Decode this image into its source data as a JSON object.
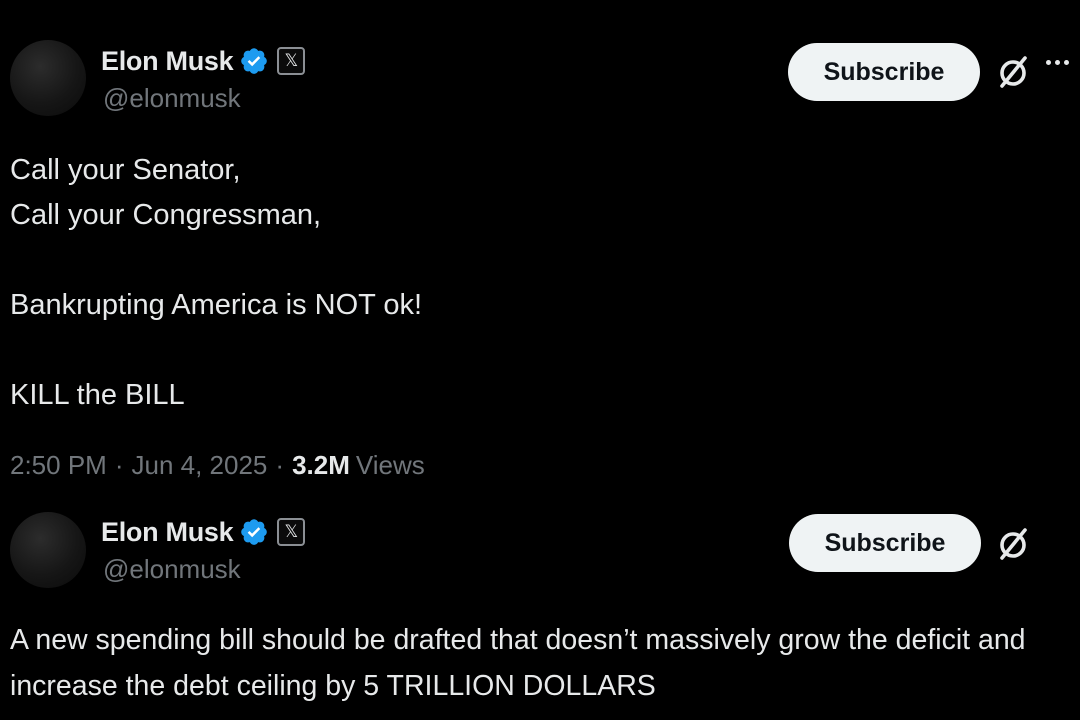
{
  "posts": [
    {
      "author": {
        "display_name": "Elon Musk",
        "handle": "@elonmusk",
        "verified_icon": "verified-badge-icon",
        "affiliate_icon": "x-logo-icon",
        "affiliate_glyph": "𝕏"
      },
      "subscribe_label": "Subscribe",
      "text": "Call your Senator,\nCall your Congressman,\n\nBankrupting America is NOT ok!\n\nKILL the BILL",
      "time": "2:50 PM",
      "date": "Jun 4, 2025",
      "separator": "·",
      "views_count": "3.2M",
      "views_label": "Views"
    },
    {
      "author": {
        "display_name": "Elon Musk",
        "handle": "@elonmusk",
        "verified_icon": "verified-badge-icon",
        "affiliate_icon": "x-logo-icon",
        "affiliate_glyph": "𝕏"
      },
      "subscribe_label": "Subscribe",
      "text": "A new spending bill should be drafted that doesn’t massively grow the deficit and increase the debt ceiling by 5 TRILLION DOLLARS"
    }
  ],
  "colors": {
    "background": "#000000",
    "text_primary": "#e7e9ea",
    "text_secondary": "#71767b",
    "verified_blue": "#1d9bf0",
    "button_bg": "#eff3f4",
    "button_text": "#0f1419"
  }
}
